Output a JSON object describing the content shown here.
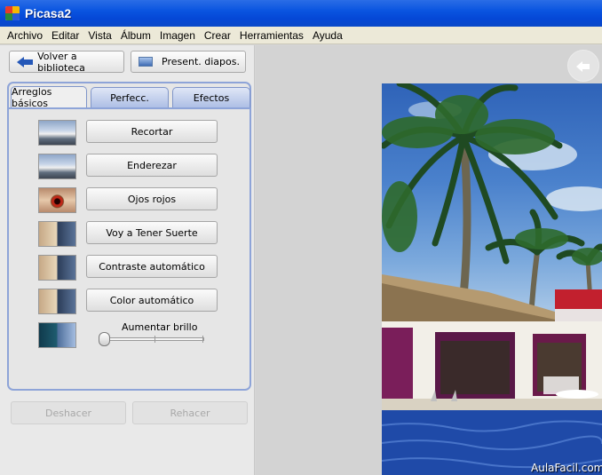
{
  "window": {
    "title": "Picasa2"
  },
  "menu": [
    "Archivo",
    "Editar",
    "Vista",
    "Álbum",
    "Imagen",
    "Crear",
    "Herramientas",
    "Ayuda"
  ],
  "nav": {
    "back_label": "Volver a biblioteca",
    "slideshow_label": "Present. diapos."
  },
  "tabs": [
    {
      "label": "Arreglos básicos",
      "active": true
    },
    {
      "label": "Perfecc.",
      "active": false
    },
    {
      "label": "Efectos",
      "active": false
    }
  ],
  "fixes": [
    {
      "label": "Recortar",
      "icon": "crop-preview-icon"
    },
    {
      "label": "Enderezar",
      "icon": "straighten-preview-icon"
    },
    {
      "label": "Ojos rojos",
      "icon": "red-eye-preview-icon"
    },
    {
      "label": "Voy a Tener Suerte",
      "icon": "lucky-preview-icon"
    },
    {
      "label": "Contraste automático",
      "icon": "contrast-preview-icon"
    },
    {
      "label": "Color automático",
      "icon": "color-preview-icon"
    }
  ],
  "brightness": {
    "label": "Aumentar brillo",
    "value": 0
  },
  "history": {
    "undo_label": "Deshacer",
    "redo_label": "Rehacer",
    "enabled": false
  },
  "watermark": "AulaFacil.com",
  "colors": {
    "titlebar": "#0a55e0",
    "tab_border": "#8ea4d8",
    "arrow": "#2457b8"
  }
}
